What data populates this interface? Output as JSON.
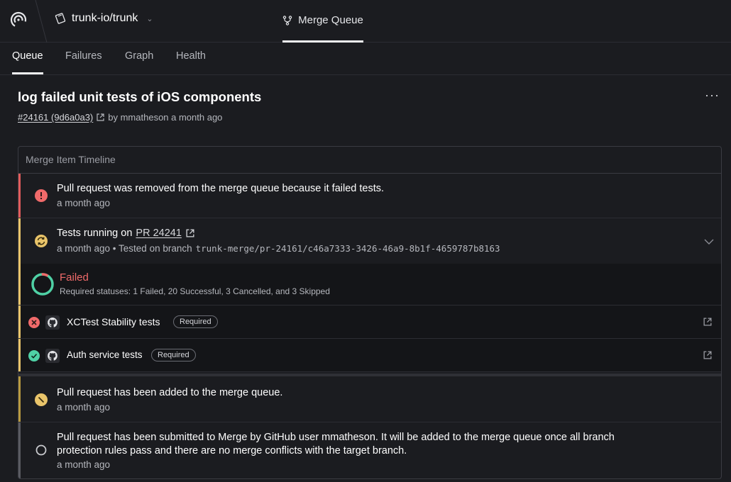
{
  "header": {
    "repo": "trunk-io/trunk",
    "active_tab": "Merge Queue"
  },
  "subnav": {
    "tabs": [
      "Queue",
      "Failures",
      "Graph",
      "Health"
    ],
    "active": "Queue"
  },
  "pr": {
    "title": "log failed unit tests of iOS components",
    "link_text": "#24161 (9d6a0a3)",
    "byline": "by mmatheson a month ago"
  },
  "timeline": {
    "heading": "Merge Item Timeline",
    "removed": {
      "text": "Pull request was removed from the merge queue because it failed tests.",
      "time": "a month ago"
    },
    "running": {
      "prefix": "Tests running on",
      "pr_link": "PR 24241",
      "time_prefix": "a month ago • Tested on branch",
      "branch": "trunk-merge/pr-24161/c46a7333-3426-46a9-8b1f-4659787b8163"
    },
    "status": {
      "label": "Failed",
      "summary": "Required statuses: 1 Failed, 20 Successful, 3 Cancelled, and 3 Skipped"
    },
    "checks": [
      {
        "name": "XCTest Stability tests",
        "badge": "Required",
        "status": "failed"
      },
      {
        "name": "Auth service tests",
        "badge": "Required",
        "status": "passed"
      }
    ],
    "added": {
      "text": "Pull request has been added to the merge queue.",
      "time": "a month ago"
    },
    "submitted": {
      "line1": "Pull request has been submitted to Merge by GitHub user mmatheson. It will be added to the merge queue once all branch",
      "line2": "protection rules pass and there are no merge conflicts with the target branch.",
      "time": "a month ago"
    }
  },
  "colors": {
    "bg": "#1b1c20",
    "failed": "#f06a6a",
    "pending": "#e9c46a",
    "success": "#4fd1a5"
  }
}
